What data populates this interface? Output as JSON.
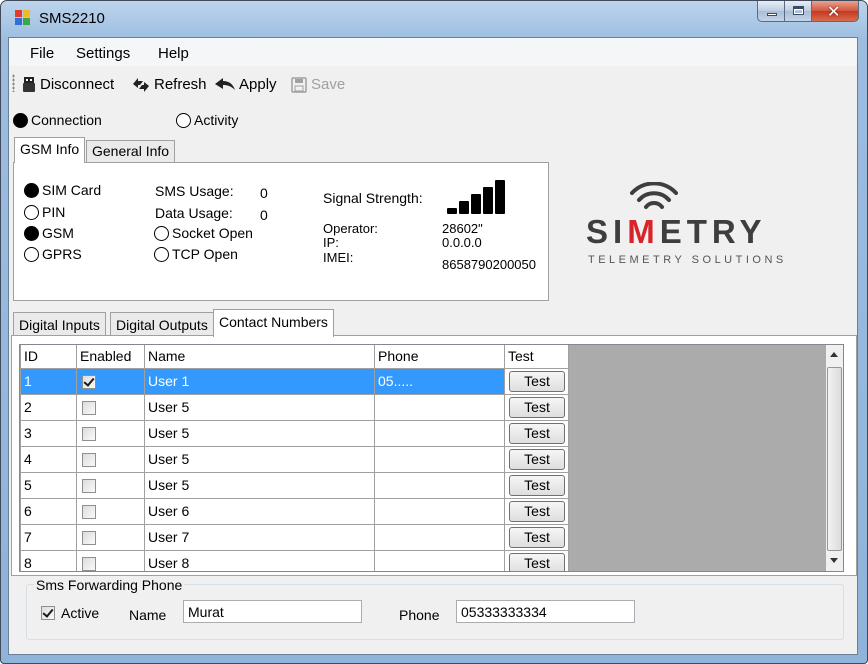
{
  "window": {
    "title": "SMS2210"
  },
  "menu": [
    "File",
    "Settings",
    "Help"
  ],
  "toolbar": {
    "disconnect": "Disconnect",
    "refresh": "Refresh",
    "apply": "Apply",
    "save": "Save"
  },
  "modes": {
    "connection": "Connection",
    "activity": "Activity",
    "selected": "connection"
  },
  "info_tabs": {
    "gsm": "GSM Info",
    "general": "General Info",
    "active": "gsm"
  },
  "gsm_info": {
    "indicators": [
      {
        "label": "SIM Card",
        "on": true
      },
      {
        "label": "PIN",
        "on": false
      },
      {
        "label": "GSM",
        "on": true
      },
      {
        "label": "GPRS",
        "on": false
      }
    ],
    "sms_usage_label": "SMS Usage:",
    "sms_usage": "0",
    "data_usage_label": "Data Usage:",
    "data_usage": "0",
    "socket_open": "Socket Open",
    "tcp_open": "TCP Open",
    "signal_label": "Signal Strength:",
    "signal_level": 5,
    "operator_label": "Operator:",
    "operator": "28602\"",
    "ip_label": "IP:",
    "ip": "0.0.0.0",
    "imei_label": "IMEI:",
    "imei": "8658790200050"
  },
  "logo": {
    "text_before": "SI",
    "text_accent": "M",
    "text_after": "ETRY",
    "subtitle": "TELEMETRY   SOLUTIONS"
  },
  "lower_tabs": {
    "inputs": "Digital Inputs",
    "outputs": "Digital Outputs",
    "contacts": "Contact Numbers",
    "active": "contacts"
  },
  "grid": {
    "columns": [
      "ID",
      "Enabled",
      "Name",
      "Phone",
      "Test"
    ],
    "test_label": "Test",
    "rows": [
      {
        "id": "1",
        "enabled": true,
        "name": "User 1",
        "phone": "05....."
      },
      {
        "id": "2",
        "enabled": false,
        "name": "User 5",
        "phone": ""
      },
      {
        "id": "3",
        "enabled": false,
        "name": "User 5",
        "phone": ""
      },
      {
        "id": "4",
        "enabled": false,
        "name": "User 5",
        "phone": ""
      },
      {
        "id": "5",
        "enabled": false,
        "name": "User 5",
        "phone": ""
      },
      {
        "id": "6",
        "enabled": false,
        "name": "User 6",
        "phone": ""
      },
      {
        "id": "7",
        "enabled": false,
        "name": "User 7",
        "phone": ""
      },
      {
        "id": "8",
        "enabled": false,
        "name": "User 8",
        "phone": ""
      }
    ]
  },
  "forwarding": {
    "title": "Sms Forwarding Phone",
    "active_label": "Active",
    "active": true,
    "name_label": "Name",
    "name_value": "Murat",
    "phone_label": "Phone",
    "phone_value": "05333333334"
  },
  "colors": {
    "selection": "#3399ff",
    "logo_accent": "#d8232a",
    "logo_text": "#3e3e3e"
  }
}
